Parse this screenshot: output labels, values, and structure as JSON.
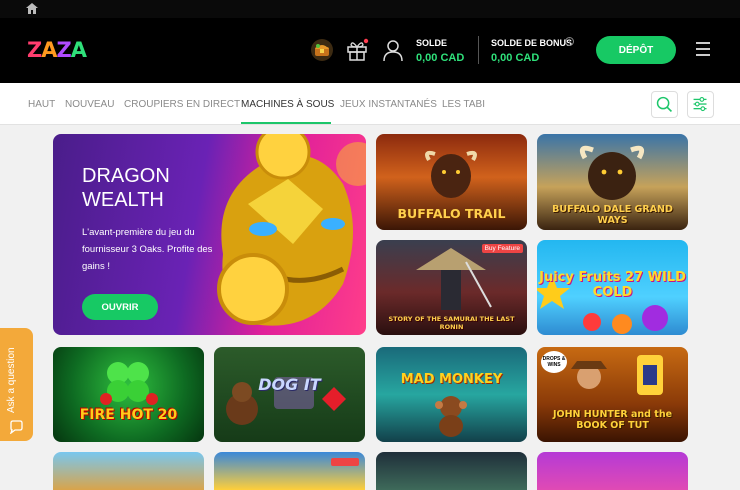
{
  "header": {
    "logo_letters": [
      "Z",
      "A",
      "Z",
      "A"
    ],
    "balance_label": "SOLDE",
    "balance_value": "0,00 CAD",
    "bonus_label": "SOLDE DE BONUS",
    "bonus_value": "0,00 CAD",
    "deposit_label": "DÉPÔT"
  },
  "nav": {
    "tabs": [
      "HAUT",
      "NOUVEAU",
      "CROUPIERS EN DIRECT",
      "MACHINES À SOUS",
      "JEUX INSTANTANÉS",
      "LES TABI"
    ],
    "active_tab": "MACHINES À SOUS"
  },
  "feature": {
    "title": "DRAGON WEALTH",
    "description": "L'avant-première du jeu du fournisseur 3 Oaks. Profite des gains !",
    "button": "OUVRIR"
  },
  "games": [
    {
      "title": "BUFFALO TRAIL"
    },
    {
      "title": "BUFFALO DALE GRAND WAYS"
    },
    {
      "title": "STORY OF THE SAMURAI THE LAST RONIN",
      "badge": "Buy Feature"
    },
    {
      "title": "Juicy Fruits 27 WILD COLD"
    },
    {
      "title": "FIRE HOT 20"
    },
    {
      "title": "DOG IT"
    },
    {
      "title": "MAD MONKEY"
    },
    {
      "title": "JOHN HUNTER and the BOOK OF TUT",
      "badge": "DROPS & WINS"
    }
  ],
  "ask_widget": {
    "label": "Ask a question"
  },
  "colors": {
    "accent_green": "#17c964",
    "balance_green": "#2fe07a",
    "ask_orange": "#f3a93a"
  },
  "icons": [
    "home-icon",
    "chest-icon",
    "gift-icon",
    "user-icon",
    "info-icon",
    "menu-icon",
    "search-icon",
    "filter-icon",
    "chat-icon"
  ]
}
